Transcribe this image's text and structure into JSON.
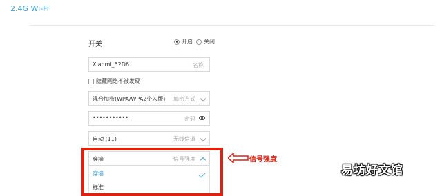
{
  "section_title": "2.4G Wi-Fi",
  "switch": {
    "label": "开关",
    "on_label": "开启",
    "off_label": "关闭",
    "selected": "on"
  },
  "name_field": {
    "value": "Xiaomi_52D6",
    "hint": "名称"
  },
  "hide_network": {
    "label": "隐藏网络不被发现",
    "checked": false
  },
  "encryption_field": {
    "value": "混合加密(WPA/WPA2个人版)",
    "hint": "加密方式"
  },
  "password_field": {
    "value": "•••••••••••",
    "hint": "密码"
  },
  "channel_field": {
    "value": "自动 (11)",
    "hint": "无线信道"
  },
  "signal_field": {
    "value": "穿墙",
    "hint": "信号强度",
    "options": [
      "穿墙",
      "标准"
    ],
    "selected_option": "穿墙"
  },
  "annotation": {
    "text": "信号强度",
    "color": "#e02010"
  },
  "watermark": "易坊好文馆",
  "colors": {
    "accent": "#3aa0d8",
    "annotation": "#e02010"
  }
}
